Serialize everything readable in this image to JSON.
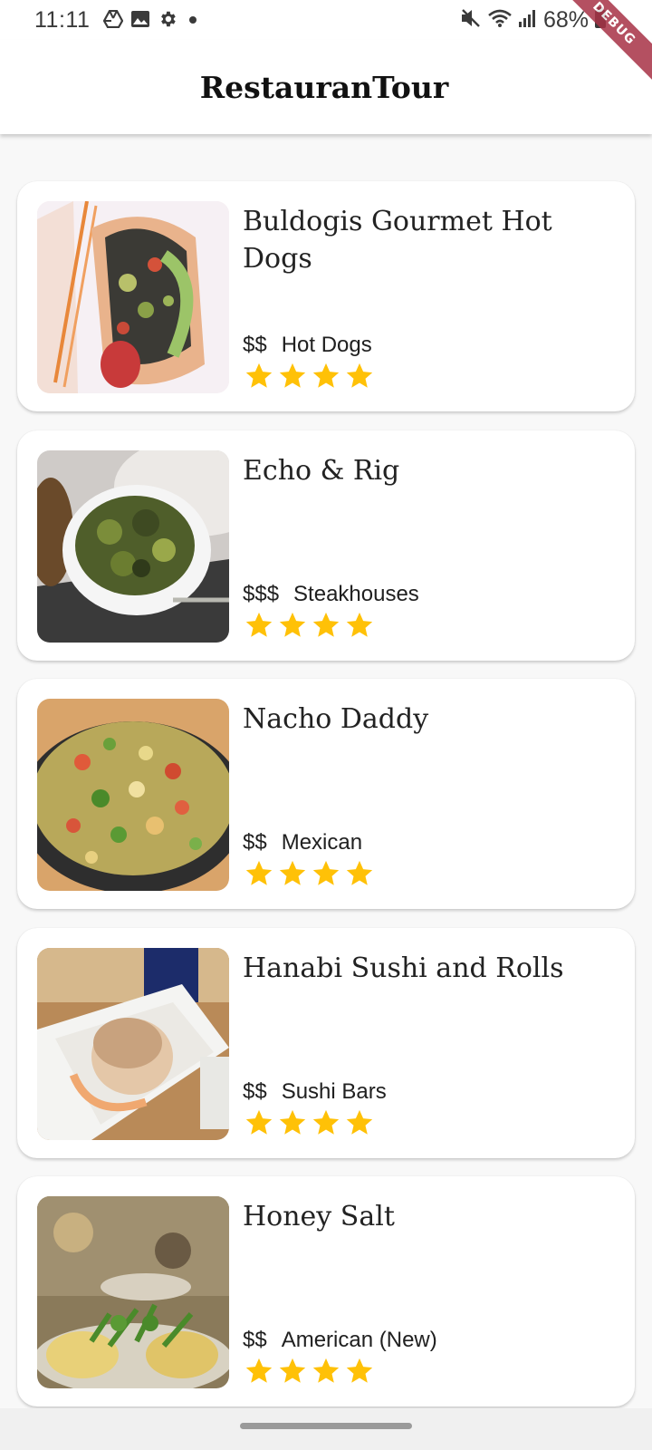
{
  "status_bar": {
    "time": "11:11",
    "left_icons": [
      "drive-icon",
      "image-icon",
      "settings-icon",
      "dot-icon"
    ],
    "right_icons": [
      "mute-icon",
      "wifi-icon",
      "signal-icon",
      "battery-icon"
    ],
    "battery": "68%"
  },
  "debug_banner": "DEBUG",
  "app_bar": {
    "title": "RestauranTour"
  },
  "restaurants": [
    {
      "name": "Buldogis Gourmet Hot Dogs",
      "price": "$$",
      "category": "Hot Dogs",
      "rating": 4,
      "image": "hot-dog-photo"
    },
    {
      "name": "Echo & Rig",
      "price": "$$$",
      "category": "Steakhouses",
      "rating": 4,
      "image": "brussels-sprouts-photo"
    },
    {
      "name": "Nacho Daddy",
      "price": "$$",
      "category": "Mexican",
      "rating": 4,
      "image": "nachos-photo"
    },
    {
      "name": "Hanabi Sushi and Rolls",
      "price": "$$",
      "category": "Sushi Bars",
      "rating": 4,
      "image": "sushi-photo"
    },
    {
      "name": "Honey Salt",
      "price": "$$",
      "category": "American (New)",
      "rating": 4,
      "image": "eggs-benedict-photo"
    }
  ],
  "colors": {
    "star": "#FFC107",
    "card": "#FFFFFF",
    "background": "#F8F8F8"
  }
}
